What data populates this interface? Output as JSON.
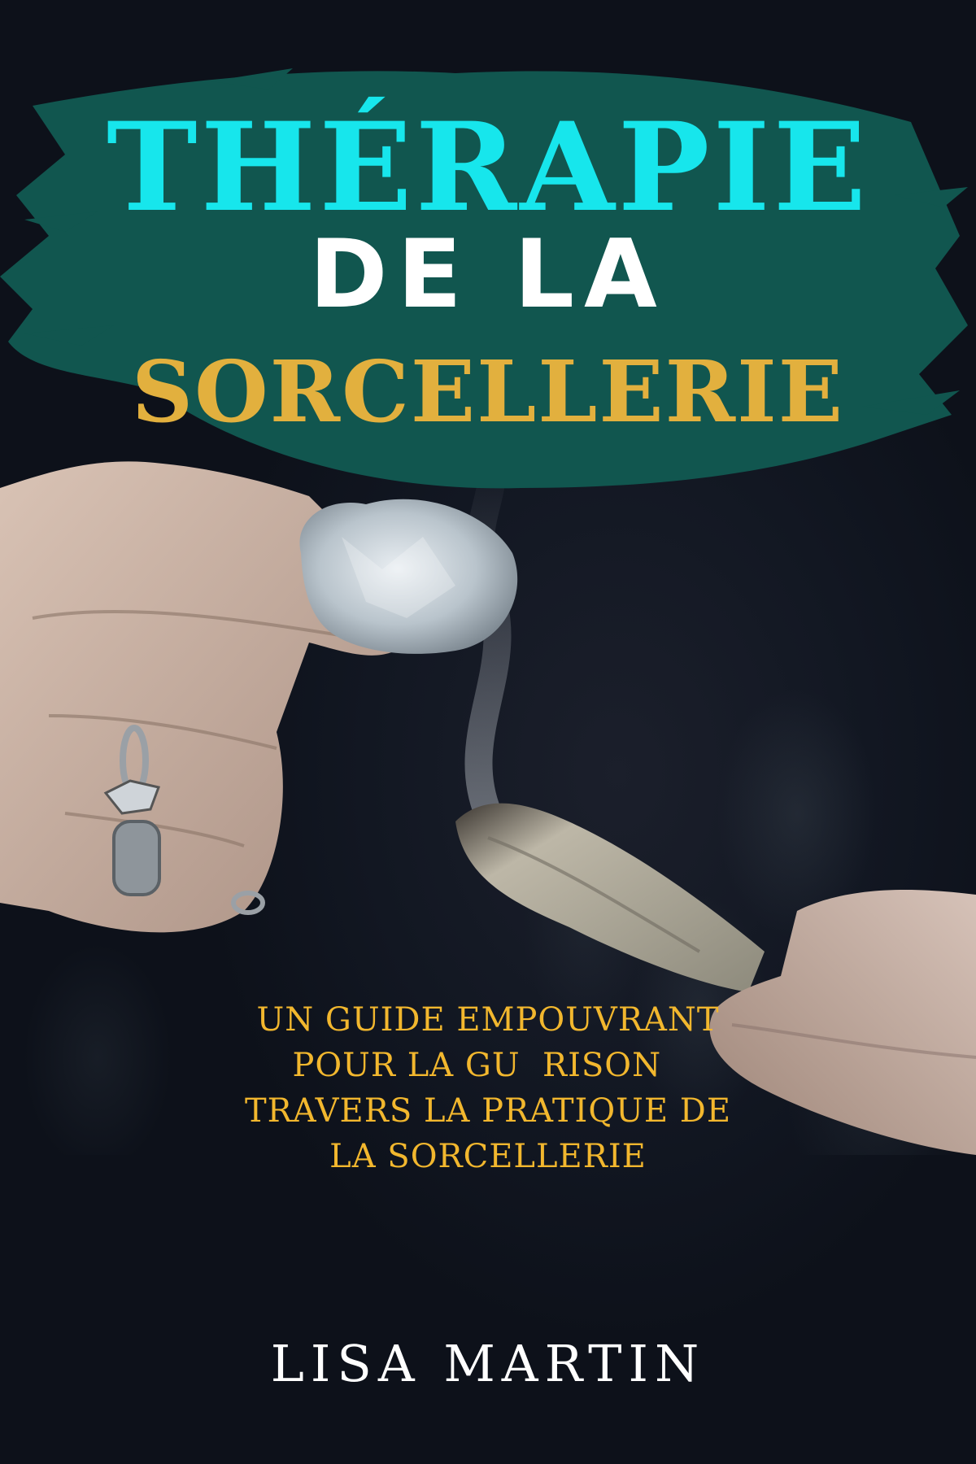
{
  "cover": {
    "title_line1": "THÉRAPIE",
    "title_line2": "DE LA",
    "title_line3": "SORCELLERIE",
    "subtitle_lines": [
      "UN GUIDE EMPOUVRANT",
      "POUR LA GU  RISON  ",
      "TRAVERS LA PRATIQUE DE",
      "LA SORCELLERIE"
    ],
    "author": "LISA MARTIN"
  },
  "colors": {
    "background": "#0f141e",
    "brush_teal": "#11564f",
    "title_cyan": "#17e6ec",
    "title_white": "#ffffff",
    "title_gold": "#e2b03e",
    "subtitle_gold": "#f2b72e"
  }
}
